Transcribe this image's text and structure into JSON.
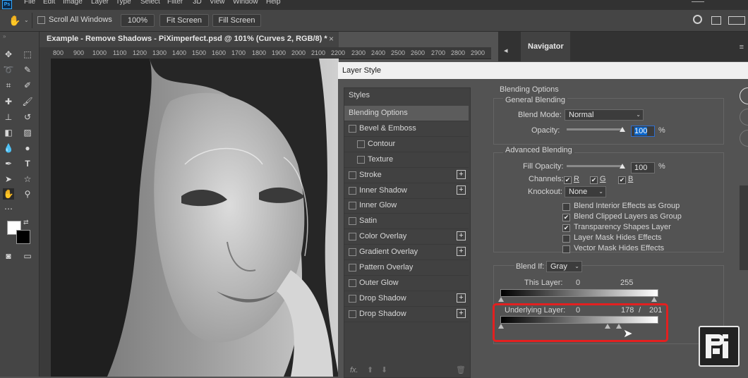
{
  "menubar": {
    "logo": "Ps",
    "items": [
      "File",
      "Edit",
      "Image",
      "Layer",
      "Type",
      "Select",
      "Filter",
      "3D",
      "View",
      "Window",
      "Help"
    ]
  },
  "options": {
    "scroll_all_label": "Scroll All Windows",
    "zoom_value": "100%",
    "fit_screen_label": "Fit Screen",
    "fill_screen_label": "Fill Screen"
  },
  "document": {
    "tab_title": "Example - Remove Shadows - PiXimperfect.psd @ 101% (Curves 2, RGB/8) *",
    "close_glyph": "×",
    "ruler_ticks": [
      "800",
      "900",
      "1000",
      "1100",
      "1200",
      "1300",
      "1400",
      "1500",
      "1600",
      "1700",
      "1800",
      "1900",
      "2000",
      "2100",
      "2200",
      "2300",
      "2400",
      "2500",
      "2600",
      "2700",
      "2800",
      "2900"
    ]
  },
  "navigator": {
    "tab_label": "Navigator"
  },
  "dialog": {
    "title": "Layer Style",
    "styles_header": "Styles",
    "style_items": [
      {
        "label": "Blending Options",
        "checkbox": false,
        "plus": false,
        "selected": true,
        "indent": false
      },
      {
        "label": "Bevel & Emboss",
        "checkbox": true,
        "plus": false,
        "selected": false,
        "indent": false
      },
      {
        "label": "Contour",
        "checkbox": true,
        "plus": false,
        "selected": false,
        "indent": true
      },
      {
        "label": "Texture",
        "checkbox": true,
        "plus": false,
        "selected": false,
        "indent": true
      },
      {
        "label": "Stroke",
        "checkbox": true,
        "plus": true,
        "selected": false,
        "indent": false
      },
      {
        "label": "Inner Shadow",
        "checkbox": true,
        "plus": true,
        "selected": false,
        "indent": false
      },
      {
        "label": "Inner Glow",
        "checkbox": true,
        "plus": false,
        "selected": false,
        "indent": false
      },
      {
        "label": "Satin",
        "checkbox": true,
        "plus": false,
        "selected": false,
        "indent": false
      },
      {
        "label": "Color Overlay",
        "checkbox": true,
        "plus": true,
        "selected": false,
        "indent": false
      },
      {
        "label": "Gradient Overlay",
        "checkbox": true,
        "plus": true,
        "selected": false,
        "indent": false
      },
      {
        "label": "Pattern Overlay",
        "checkbox": true,
        "plus": false,
        "selected": false,
        "indent": false
      },
      {
        "label": "Outer Glow",
        "checkbox": true,
        "plus": false,
        "selected": false,
        "indent": false
      },
      {
        "label": "Drop Shadow",
        "checkbox": true,
        "plus": true,
        "selected": false,
        "indent": false
      },
      {
        "label": "Drop Shadow",
        "checkbox": true,
        "plus": true,
        "selected": false,
        "indent": false
      }
    ],
    "blending": {
      "section_title": "Blending Options",
      "general_title": "General Blending",
      "blend_mode_label": "Blend Mode:",
      "blend_mode_value": "Normal",
      "opacity_label": "Opacity:",
      "opacity_value": "100",
      "percent": "%",
      "advanced_title": "Advanced Blending",
      "fill_opacity_label": "Fill Opacity:",
      "fill_opacity_value": "100",
      "channels_label": "Channels:",
      "channel_r": "R",
      "channel_g": "G",
      "channel_b": "B",
      "knockout_label": "Knockout:",
      "knockout_value": "None",
      "options": [
        {
          "label": "Blend Interior Effects as Group",
          "checked": false
        },
        {
          "label": "Blend Clipped Layers as Group",
          "checked": true
        },
        {
          "label": "Transparency Shapes Layer",
          "checked": true
        },
        {
          "label": "Layer Mask Hides Effects",
          "checked": false
        },
        {
          "label": "Vector Mask Hides Effects",
          "checked": false
        }
      ],
      "blend_if_label": "Blend If:",
      "blend_if_value": "Gray",
      "this_layer_label": "This Layer:",
      "this_layer_low": "0",
      "this_layer_high": "255",
      "underlying_label": "Underlying Layer:",
      "underlying_low": "0",
      "underlying_high_a": "178",
      "slash": "/",
      "underlying_high_b": "201"
    }
  },
  "accent_colors": {
    "highlight": "#e32020",
    "selection": "#0a64c8"
  }
}
